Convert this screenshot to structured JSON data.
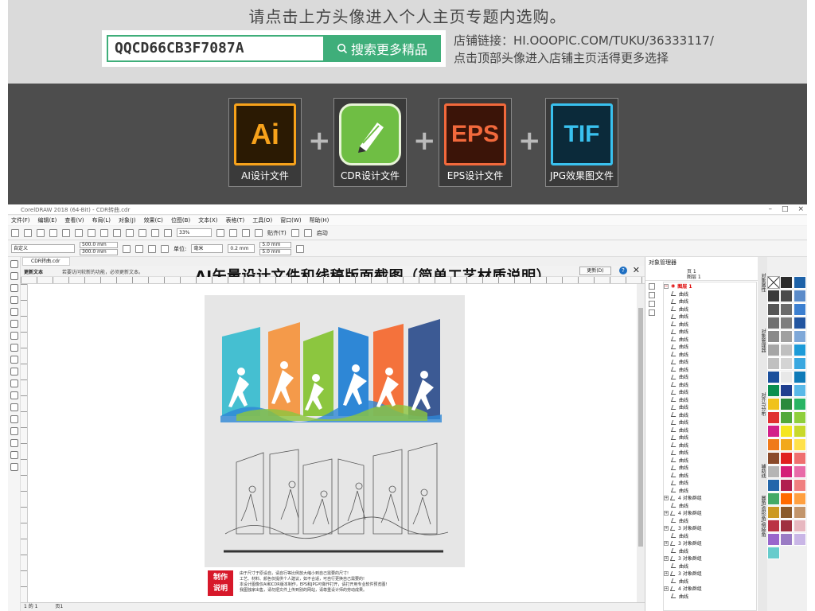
{
  "promo": {
    "headline": "请点击上方头像进入个人主页专题内选购。",
    "code": "QQCD66CB3F7087A",
    "search_label": "搜索更多精品",
    "shop_line1": "店铺链接：HI.OOOPIC.COM/TUKU/36333117/",
    "shop_line2": "点击顶部头像进入店铺主页活得更多选择"
  },
  "software": [
    {
      "icon_text": "Ai",
      "label": "AI设计文件",
      "bg": "#2b1a03",
      "fg": "#f7a21b",
      "border": "#f7a21b"
    },
    {
      "icon_text": "",
      "label": "CDR设计文件",
      "bg": "#6fbe44",
      "fg": "#ffffff",
      "border": "#ffffff"
    },
    {
      "icon_text": "EPS",
      "label": "EPS设计文件",
      "bg": "#3b1408",
      "fg": "#f2693c",
      "border": "#f2693c"
    },
    {
      "icon_text": "TIF",
      "label": "JPG效果图文件",
      "bg": "#0b2a3a",
      "fg": "#39c1ef",
      "border": "#39c1ef"
    }
  ],
  "corel": {
    "window_title": "CorelDRAW 2018 (64-Bit) - CDR转曲.cdr",
    "menu": [
      "文件(F)",
      "编辑(E)",
      "查看(V)",
      "布局(L)",
      "对象(J)",
      "效果(C)",
      "位图(B)",
      "文本(X)",
      "表格(T)",
      "工具(O)",
      "窗口(W)",
      "帮助(H)"
    ],
    "zoom": "33%",
    "snap_label": "贴齐(T)",
    "start_label": "启动",
    "preset": "自定义",
    "width": "500.0 mm",
    "height": "300.0 mm",
    "unit_label": "单位:",
    "unit_value": "毫米",
    "nudge": "0.2 mm",
    "dup_x": "5.0 mm",
    "dup_y": "5.0 mm",
    "doc_tab": "CDR转曲.cdr",
    "hint_title": "更新文本",
    "hint_text": "若要访问较新的功能，必须更新文本。",
    "update_btn": "更新(D)",
    "overlay_title": "AI矢量设计文件和线稿版面截图（简单工艺材质说明）",
    "status_page": "1 的 1",
    "status_tab": "页1",
    "note_label_1": "制作",
    "note_label_2": "说明",
    "notes": [
      "由于尺寸于原设自，请自行等比例放大缩小到自己需要的尺寸!",
      "工艺、材料、颜色仅提供个人建议，如不合适，可自行更换自己需要的!",
      "本设计图像仅AI和CDR版本制作，EPS和JPG可做作打开，请打开用专业软件预览图!",
      "我图独家出售，请勿把文件上传到别的网站，请尊重设计师的劳动成果。"
    ]
  },
  "objmgr": {
    "title": "对象管理器",
    "page": "页 1",
    "layer_label": "图层 1",
    "layer_row": "图层 1",
    "items": [
      "曲线",
      "曲线",
      "曲线",
      "曲线",
      "曲线",
      "曲线",
      "曲线",
      "曲线",
      "曲线",
      "曲线",
      "曲线",
      "曲线",
      "曲线",
      "曲线",
      "曲线",
      "曲线",
      "曲线",
      "曲线",
      "曲线",
      "曲线",
      "曲线",
      "曲线",
      "曲线",
      "曲线",
      "曲线",
      "曲线",
      "曲线",
      "4 对象群组",
      "曲线",
      "4 对象群组",
      "曲线",
      "3 对象群组",
      "曲线",
      "3 对象群组",
      "曲线",
      "3 对象群组",
      "曲线",
      "3 对象群组",
      "曲线",
      "4 对象群组",
      "曲线"
    ]
  },
  "dock_tabs": [
    "对象属性",
    "对象管理器",
    "对齐与分布",
    "辅助线",
    "圆角/扇形角/倒棱角"
  ],
  "palette": [
    "#2b2b2b",
    "#1e62a8",
    "#4b4b4b",
    "#5b8bc9",
    "#6b6b6b",
    "#3c7fd0",
    "#7e7e7e",
    "#2255a0",
    "#a0a0a0",
    "#7fa8d8",
    "#bfbfbf",
    "#1d9bd8",
    "#d4d4d4",
    "#3aa8e0",
    "#e8e8e8",
    "#0f7bb8",
    "#1f3f8f",
    "#59b9e8",
    "#2a8a3c",
    "#28b463",
    "#52a83a",
    "#8fcf3c",
    "#f4e61e",
    "#c8d92a",
    "#f2a81b",
    "#ffe14a",
    "#e02020",
    "#ef6f6f",
    "#d41f78",
    "#e86ba8",
    "#b01e50",
    "#f08080",
    "#ff6a00",
    "#ffa040",
    "#8a5a2b",
    "#c2956b",
    "#a03040",
    "#e7b8c0",
    "#9a7bc4",
    "#c9b6e6"
  ],
  "chart_colors": {
    "teal": "#45bfd1",
    "orange": "#f49a4a",
    "green": "#8cc63f",
    "blue": "#2e87d6",
    "coral": "#f4723c",
    "navy": "#3c5a94"
  }
}
